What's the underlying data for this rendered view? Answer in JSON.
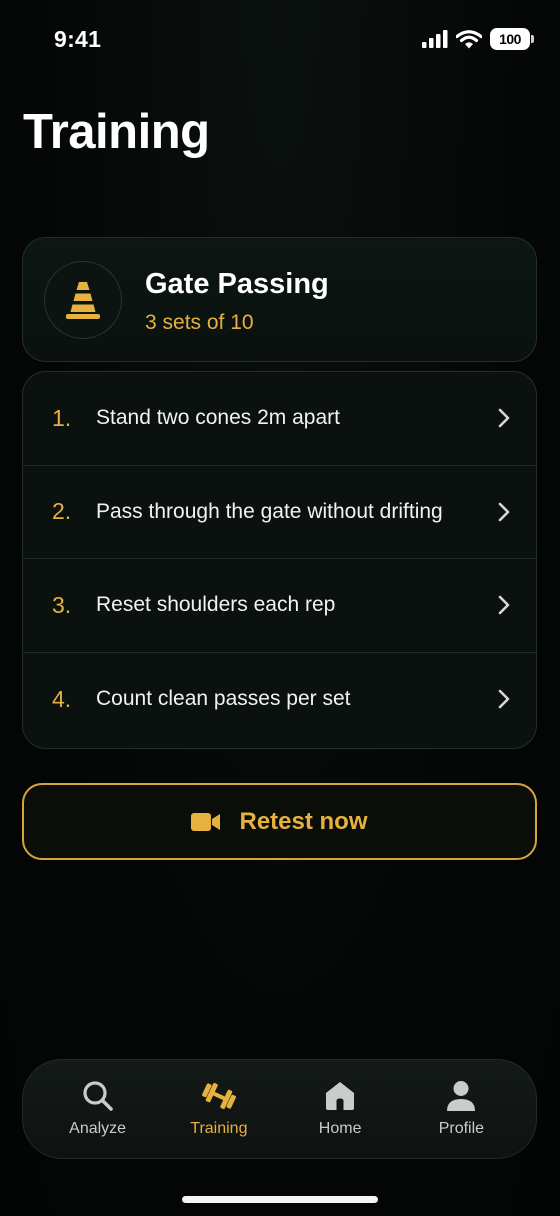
{
  "status_bar": {
    "time": "9:41",
    "battery": "100"
  },
  "page": {
    "title": "Training"
  },
  "drill": {
    "name": "Gate Passing",
    "subtitle": "3 sets of 10",
    "icon": "traffic-cone-icon"
  },
  "steps": [
    {
      "number": "1.",
      "text": "Stand two cones 2m apart"
    },
    {
      "number": "2.",
      "text": "Pass through the gate without drifting"
    },
    {
      "number": "3.",
      "text": "Reset shoulders each rep"
    },
    {
      "number": "4.",
      "text": "Count clean passes per set"
    }
  ],
  "retest": {
    "label": "Retest now",
    "icon": "video-camera-icon"
  },
  "tabs": [
    {
      "label": "Analyze",
      "icon": "search-icon",
      "active": false
    },
    {
      "label": "Training",
      "icon": "dumbbell-icon",
      "active": true
    },
    {
      "label": "Home",
      "icon": "home-icon",
      "active": false
    },
    {
      "label": "Profile",
      "icon": "person-icon",
      "active": false
    }
  ],
  "colors": {
    "accent": "#e6b13e",
    "background": "#040706",
    "card": "#0a110f",
    "border": "#22302b"
  }
}
